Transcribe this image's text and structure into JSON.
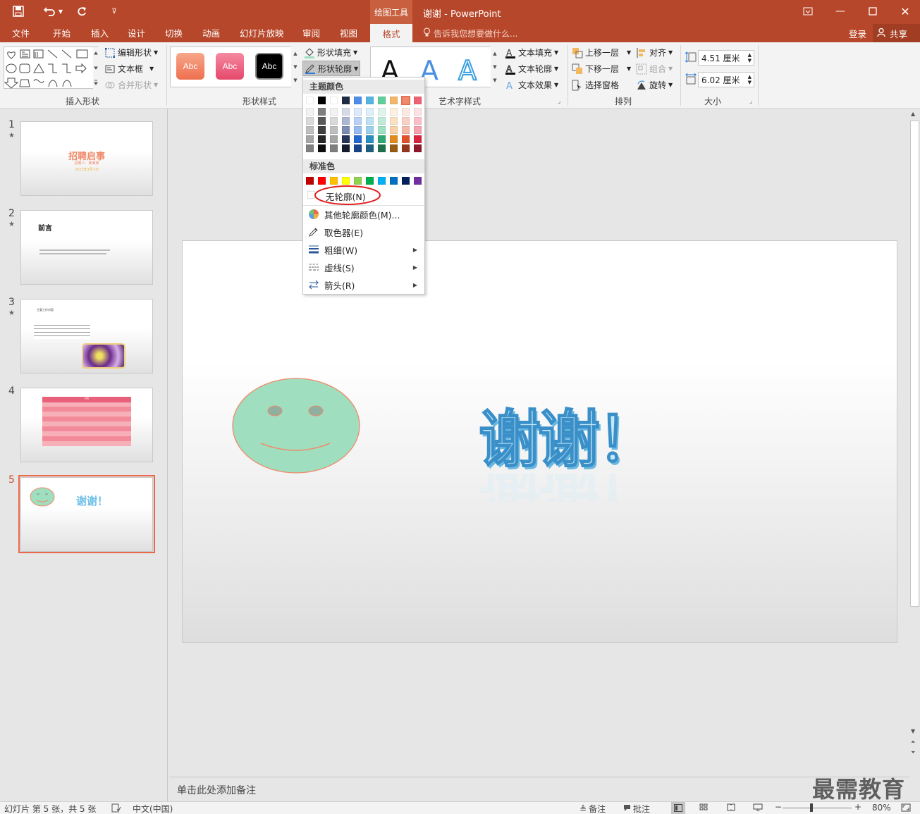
{
  "titlebar": {
    "context_group": "绘图工具",
    "title": "谢谢 - PowerPoint"
  },
  "tabs": [
    "文件",
    "开始",
    "插入",
    "设计",
    "切换",
    "动画",
    "幻灯片放映",
    "审阅",
    "视图"
  ],
  "active_tab": "格式",
  "tell_me": "告诉我您想要做什么...",
  "login": "登录",
  "share": "共享",
  "ribbon": {
    "insert_shapes": {
      "label": "插入形状",
      "edit_shape": "编辑形状",
      "text_box": "文本框",
      "merge_shapes": "合并形状"
    },
    "shape_styles": {
      "label": "形状样式",
      "chip_text": "Abc",
      "fill": "形状填充",
      "outline": "形状轮廓"
    },
    "wordart": {
      "label": "艺术字样式",
      "text_fill": "文本填充",
      "text_outline": "文本轮廓",
      "text_effect": "文本效果"
    },
    "arrange": {
      "label": "排列",
      "bring_forward": "上移一层",
      "send_backward": "下移一层",
      "selection_pane": "选择窗格",
      "align": "对齐",
      "group": "组合",
      "rotate": "旋转"
    },
    "size": {
      "label": "大小",
      "height": "4.51 厘米",
      "width": "6.02 厘米"
    }
  },
  "dropdown": {
    "theme_colors": "主题颜色",
    "standard_colors": "标准色",
    "no_outline": "无轮廓(N)",
    "more_colors": "其他轮廓颜色(M)...",
    "eyedropper": "取色器(E)",
    "weight": "粗细(W)",
    "dashes": "虚线(S)",
    "arrows": "箭头(R)"
  },
  "slides": [
    {
      "num": "1",
      "star": "★",
      "title": "招聘启事",
      "sub": "招聘人：某某某",
      "date": "2023年1月1日"
    },
    {
      "num": "2",
      "star": "★",
      "title": "前言"
    },
    {
      "num": "3",
      "star": "★",
      "title": "主要工作内容"
    },
    {
      "num": "4",
      "star": "",
      "title": "表格"
    },
    {
      "num": "5",
      "star": "",
      "title": "谢谢！"
    }
  ],
  "slide_main": {
    "text": "谢谢！"
  },
  "notes_placeholder": "单击此处添加备注",
  "watermark": "最需教育",
  "status": {
    "slide_info": "幻灯片 第 5 张，共 5 张",
    "language": "中文(中国)",
    "notes": "备注",
    "comments": "批注",
    "zoom": "80%"
  },
  "colors": {
    "accent": "#b7472a",
    "smiley_fill": "#9fdfc0",
    "smiley_outline": "#f08a6a",
    "wordart_blue": "#5fb6e6"
  }
}
